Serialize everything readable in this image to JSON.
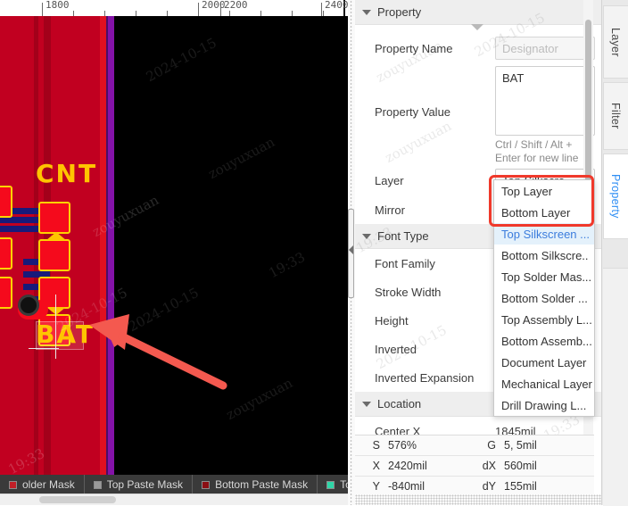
{
  "ruler": {
    "labels": [
      "1800",
      "2000",
      "2200",
      "2400"
    ],
    "unit": "mil"
  },
  "canvas": {
    "silkscreen_top": "CNT",
    "silkscreen_bottom": "BAT",
    "watermarks": [
      "2024-10-15",
      "19:33",
      "zouyuxuan"
    ]
  },
  "layer_bar": {
    "items": [
      {
        "label": "older Mask",
        "color": "#c12028",
        "truncated": true
      },
      {
        "label": "Top Paste Mask",
        "color": "#9a9a9a"
      },
      {
        "label": "Bottom Paste Mask",
        "color": "#8b0f14"
      },
      {
        "label": "Top Assem",
        "color": "#2fd6a8",
        "truncated": true
      }
    ]
  },
  "panel": {
    "sections": [
      {
        "title": "Property"
      },
      {
        "title": "Font Type"
      },
      {
        "title": "Location"
      }
    ],
    "property": {
      "name_label": "Property Name",
      "name_placeholder": "Designator",
      "name_value": "",
      "value_label": "Property Value",
      "value_text": "BAT",
      "value_hint": "Ctrl / Shift / Alt + Enter for new line",
      "layer_label": "Layer",
      "layer_value": "Top Silkscre...",
      "mirror_label": "Mirror"
    },
    "font_type": {
      "font_family_label": "Font Family",
      "stroke_width_label": "Stroke Width",
      "height_label": "Height",
      "inverted_label": "Inverted",
      "inverted_expansion_label": "Inverted Expansion"
    },
    "location": {
      "center_x_label": "Center X",
      "center_x_value": "1845mil"
    },
    "layer_dropdown": {
      "open": true,
      "selected": "Top Silkscreen ...",
      "highlight_color": "#f0392b",
      "options": [
        "Top Layer",
        "Bottom Layer",
        "Top Silkscreen ...",
        "Bottom Silkscre..",
        "Top Solder Mas...",
        "Bottom Solder ...",
        "Top Assembly L...",
        "Bottom Assemb...",
        "Document Layer",
        "Mechanical Layer",
        "Drill Drawing L..."
      ]
    }
  },
  "status": {
    "rows": [
      {
        "k1": "S",
        "v1": "576%",
        "k2": "G",
        "v2": "5, 5mil"
      },
      {
        "k1": "X",
        "v1": "2420mil",
        "k2": "dX",
        "v2": "560mil"
      },
      {
        "k1": "Y",
        "v1": "-840mil",
        "k2": "dY",
        "v2": "155mil"
      }
    ]
  },
  "rail": {
    "tabs": [
      {
        "label": "Layer",
        "active": false
      },
      {
        "label": "Filter",
        "active": false
      },
      {
        "label": "Property",
        "active": true
      }
    ],
    "accent": "#2f8ef4"
  }
}
